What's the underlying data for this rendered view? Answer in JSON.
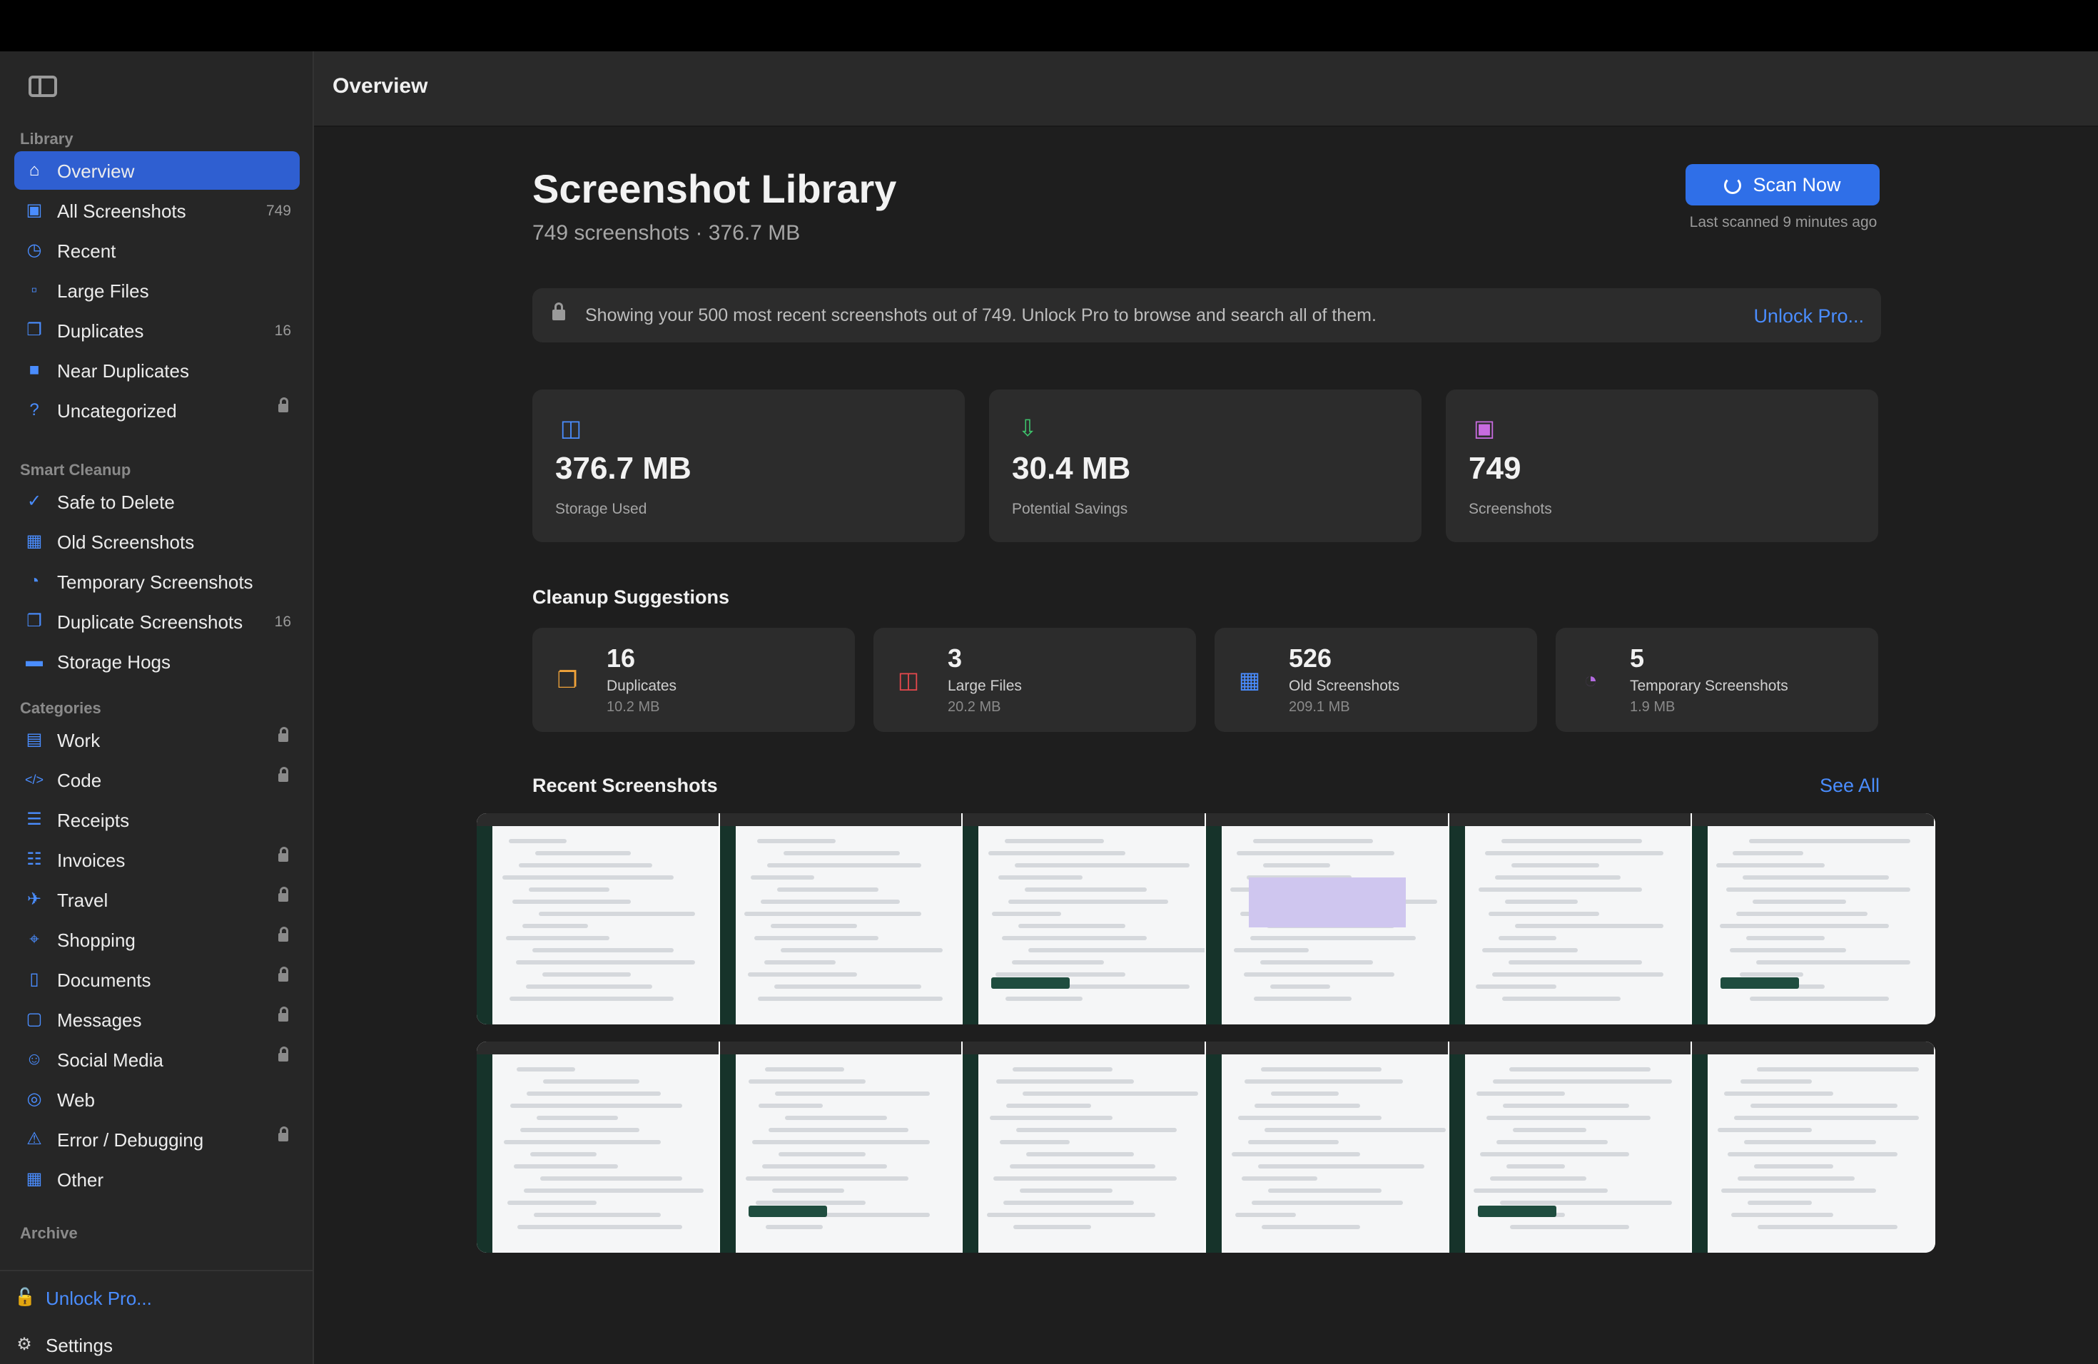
{
  "header": {
    "title": "Overview"
  },
  "sidebar": {
    "sections": {
      "library": "Library",
      "smart_cleanup": "Smart Cleanup",
      "categories": "Categories",
      "archive": "Archive"
    },
    "library_items": [
      {
        "label": "Overview",
        "icon": "home-icon",
        "active": true
      },
      {
        "label": "All Screenshots",
        "count": "749",
        "icon": "photo-stack-icon"
      },
      {
        "label": "Recent",
        "icon": "clock-icon"
      },
      {
        "label": "Large Files",
        "icon": "drive-icon"
      },
      {
        "label": "Duplicates",
        "count": "16",
        "icon": "duplicate-icon"
      },
      {
        "label": "Near Duplicates",
        "icon": "near-duplicate-icon"
      },
      {
        "label": "Uncategorized",
        "icon": "question-icon",
        "locked": true
      }
    ],
    "cleanup_items": [
      {
        "label": "Safe to Delete",
        "icon": "checkmark-circle-icon"
      },
      {
        "label": "Old Screenshots",
        "icon": "calendar-icon"
      },
      {
        "label": "Temporary Screenshots",
        "icon": "timer-icon"
      },
      {
        "label": "Duplicate Screenshots",
        "count": "16",
        "icon": "duplicate-doc-icon"
      },
      {
        "label": "Storage Hogs",
        "icon": "disk-icon"
      }
    ],
    "category_items": [
      {
        "label": "Work",
        "icon": "briefcase-icon",
        "locked": true
      },
      {
        "label": "Code",
        "icon": "code-icon",
        "locked": true
      },
      {
        "label": "Receipts",
        "icon": "receipt-icon"
      },
      {
        "label": "Invoices",
        "icon": "invoice-icon",
        "locked": true
      },
      {
        "label": "Travel",
        "icon": "airplane-icon",
        "locked": true
      },
      {
        "label": "Shopping",
        "icon": "cart-icon",
        "locked": true
      },
      {
        "label": "Documents",
        "icon": "document-icon",
        "locked": true
      },
      {
        "label": "Messages",
        "icon": "message-icon",
        "locked": true
      },
      {
        "label": "Social Media",
        "icon": "people-icon",
        "locked": true
      },
      {
        "label": "Web",
        "icon": "globe-icon"
      },
      {
        "label": "Error / Debugging",
        "icon": "warning-icon",
        "locked": true
      },
      {
        "label": "Other",
        "icon": "grid-icon"
      }
    ],
    "unlock_label": "Unlock Pro...",
    "settings_label": "Settings"
  },
  "library": {
    "title": "Screenshot Library",
    "subtitle": "749 screenshots · 376.7 MB",
    "scan_button": "Scan Now",
    "last_scanned": "Last scanned 9 minutes ago"
  },
  "banner": {
    "text": "Showing your 500 most recent screenshots out of 749. Unlock Pro to browse and search all of them.",
    "link": "Unlock Pro..."
  },
  "stats": [
    {
      "value": "376.7 MB",
      "label": "Storage Used",
      "icon": "drive-icon",
      "color": "#4a8dff"
    },
    {
      "value": "30.4 MB",
      "label": "Potential Savings",
      "icon": "download-circle-icon",
      "color": "#3ec46d"
    },
    {
      "value": "749",
      "label": "Screenshots",
      "icon": "photo-stack-icon",
      "color": "#c86be0"
    }
  ],
  "cleanup": {
    "title": "Cleanup Suggestions",
    "items": [
      {
        "value": "16",
        "label": "Duplicates",
        "size": "10.2 MB",
        "icon": "duplicate-icon",
        "color": "#f0a33a"
      },
      {
        "value": "3",
        "label": "Large Files",
        "size": "20.2 MB",
        "icon": "drive-icon",
        "color": "#e5484d"
      },
      {
        "value": "526",
        "label": "Old Screenshots",
        "size": "209.1 MB",
        "icon": "calendar-icon",
        "color": "#4a8dff"
      },
      {
        "value": "5",
        "label": "Temporary Screenshots",
        "size": "1.9 MB",
        "icon": "timer-icon",
        "color": "#b36be0"
      }
    ]
  },
  "recent": {
    "title": "Recent Screenshots",
    "see_all": "See All"
  }
}
